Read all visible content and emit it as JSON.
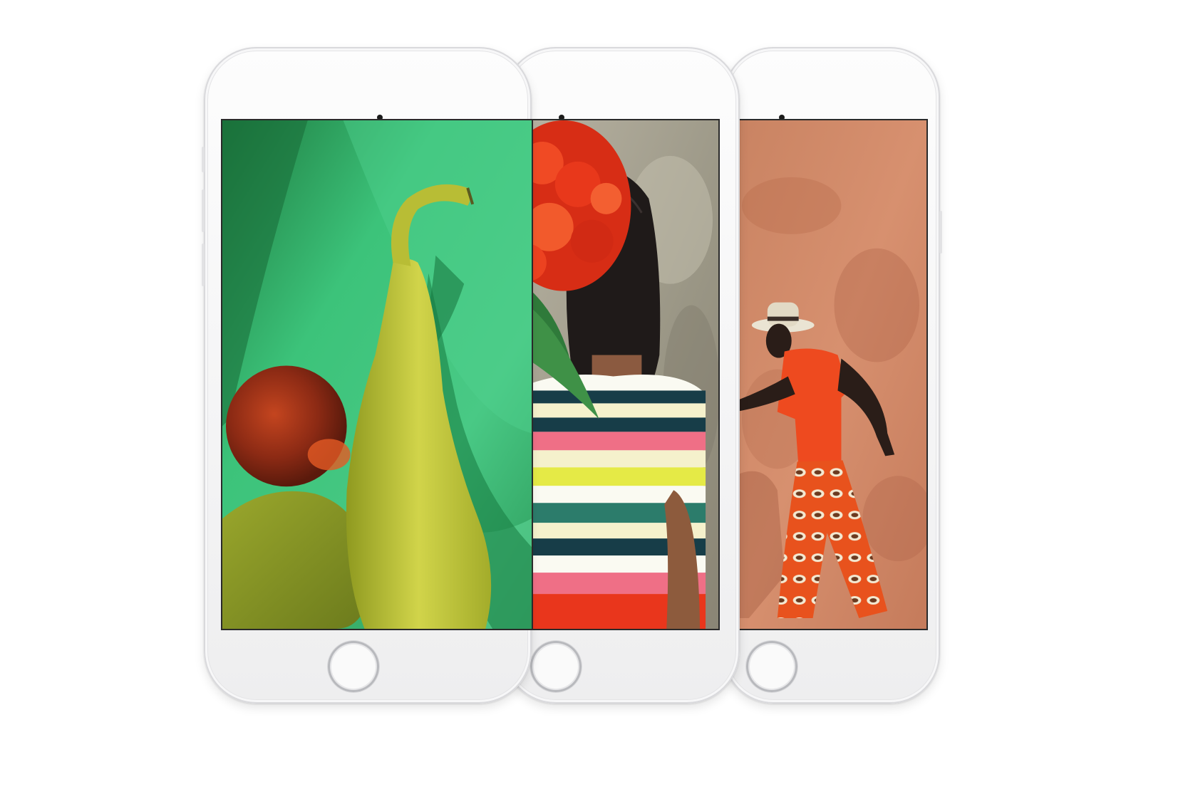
{
  "scene": {
    "background_color": "#ffffff",
    "phone_color": "#f4f4f5",
    "phones": [
      {
        "name": "left",
        "photo": "green-fabric-fruit",
        "palette": {
          "primary": "#3cc37a",
          "accent": "#c6cc3e",
          "fruit": "#b3321a"
        },
        "icons": [
          "front-camera-icon",
          "earpiece-speaker-icon",
          "home-button-icon"
        ]
      },
      {
        "name": "middle",
        "photo": "woman-striped-shirt-red-flower",
        "palette": {
          "primary": "#9c9887",
          "accent": "#e9361c",
          "stripes": [
            "#173d48",
            "#f5f1cc",
            "#ef6f86",
            "#e5ea46",
            "#2c7c6b",
            "#fafaf2"
          ]
        },
        "icons": [
          "sensor-icon",
          "earpiece-speaker-icon",
          "home-button-icon"
        ]
      },
      {
        "name": "right",
        "photo": "man-hat-orange-wall",
        "palette": {
          "primary": "#d48b6a",
          "accent": "#f0471c",
          "pattern": "#e8521d"
        },
        "icons": [
          "sensor-icon",
          "earpiece-speaker-icon",
          "home-button-icon"
        ]
      }
    ]
  }
}
